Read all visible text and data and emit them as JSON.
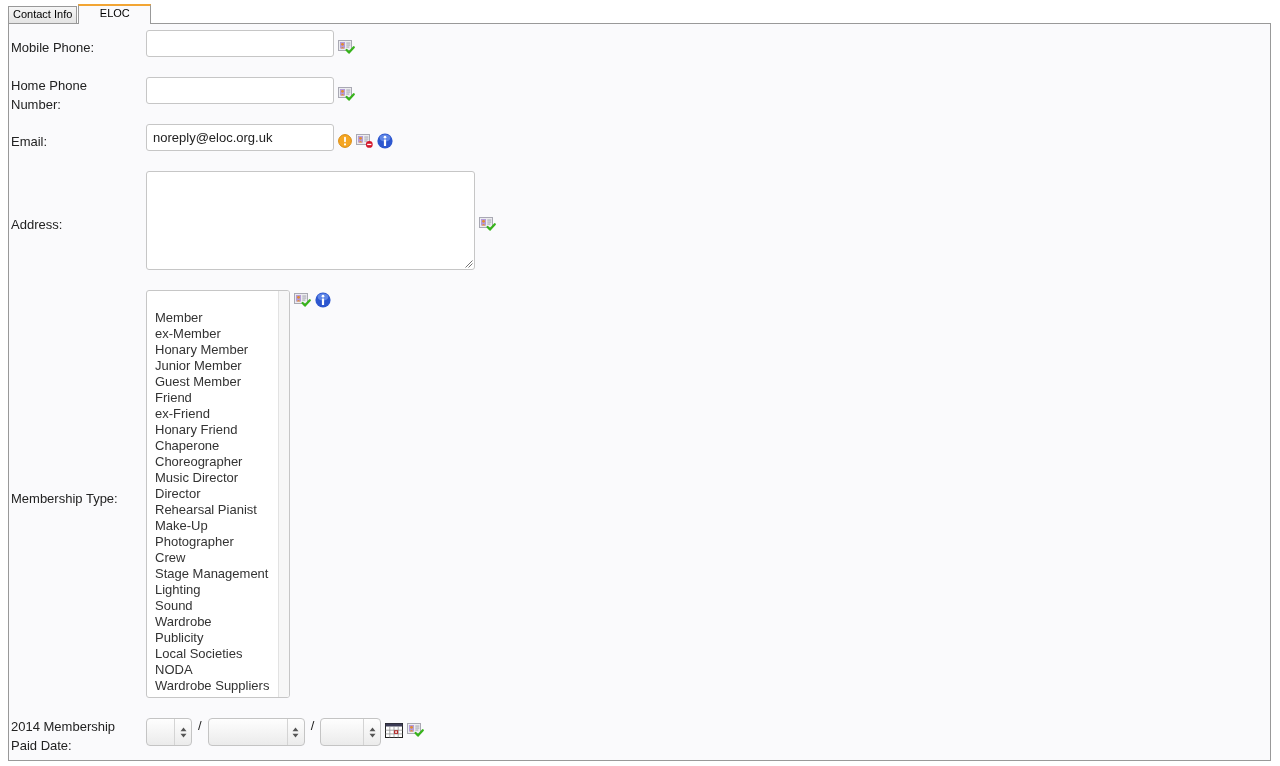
{
  "tabs": [
    {
      "label": "Contact Info",
      "selected": false
    },
    {
      "label": "ELOC",
      "selected": true
    }
  ],
  "fields": [
    {
      "label": "Mobile Phone:",
      "kind": "text",
      "warning": false,
      "shared": true,
      "info": false
    },
    {
      "label": "Home Phone Number:",
      "kind": "text",
      "warning": false,
      "shared": true,
      "info": false
    },
    {
      "label": "Email:",
      "kind": "text",
      "value": "noreply@eloc.org.uk",
      "warning": true,
      "shared": false,
      "info": true
    },
    {
      "label": "Address:",
      "kind": "textarea",
      "warning": false,
      "shared": true,
      "info": false
    },
    {
      "label": "Membership Type:",
      "kind": "listbox",
      "warning": false,
      "shared": true,
      "info": true,
      "options": [
        {
          "label": "Member",
          "selected": false
        },
        {
          "label": "ex-Member",
          "selected": false
        },
        {
          "label": "Honary Member",
          "selected": false
        },
        {
          "label": "Junior Member",
          "selected": false
        },
        {
          "label": "Guest Member",
          "selected": false
        },
        {
          "label": "Friend",
          "selected": false
        },
        {
          "label": "ex-Friend",
          "selected": false
        },
        {
          "label": "Honary Friend",
          "selected": false
        },
        {
          "label": "Chaperone",
          "selected": false
        },
        {
          "label": "Choreographer",
          "selected": false
        },
        {
          "label": "Music Director",
          "selected": false
        },
        {
          "label": "Director",
          "selected": false
        },
        {
          "label": "Rehearsal Pianist",
          "selected": false
        },
        {
          "label": "Make-Up",
          "selected": false
        },
        {
          "label": "Photographer",
          "selected": false
        },
        {
          "label": "Crew",
          "selected": false
        },
        {
          "label": "Stage Management",
          "selected": false
        },
        {
          "label": "Lighting",
          "selected": false
        },
        {
          "label": "Sound",
          "selected": false
        },
        {
          "label": "Wardrobe",
          "selected": false
        },
        {
          "label": "Publicity",
          "selected": false
        },
        {
          "label": "Local Societies",
          "selected": false
        },
        {
          "label": "NODA",
          "selected": false
        },
        {
          "label": "Wardrobe Suppliers",
          "selected": false
        }
      ]
    },
    {
      "label": "2014 Membership Paid Date:",
      "kind": "date",
      "separators": [
        "/",
        "/"
      ],
      "warning": false,
      "shared": true,
      "info": false
    }
  ]
}
